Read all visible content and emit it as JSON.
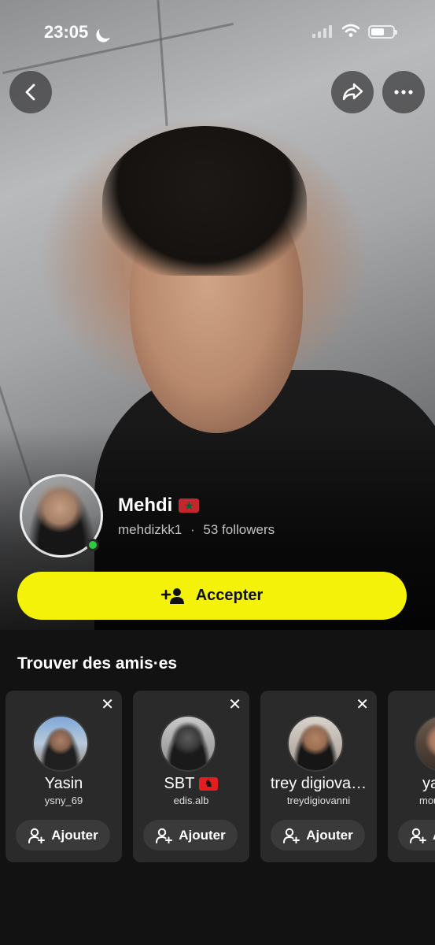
{
  "status_bar": {
    "time": "23:05"
  },
  "profile": {
    "display_name": "Mehdi",
    "display_name_flag": "morocco-flag",
    "username": "mehdizkk1",
    "separator": "·",
    "followers": "53 followers",
    "online": true
  },
  "actions": {
    "accept_label": "Accepter"
  },
  "find_friends": {
    "title": "Trouver des amis·es",
    "cards": [
      {
        "name": "Yasin",
        "handle": "ysny_69",
        "add_label": "Ajouter",
        "close": "✕"
      },
      {
        "name": "SBT",
        "flag": "albania-flag",
        "handle": "edis.alb",
        "add_label": "Ajouter",
        "close": "✕"
      },
      {
        "name": "trey digiova…",
        "handle": "treydigiovanni",
        "add_label": "Ajouter",
        "close": "✕"
      },
      {
        "name": "ya",
        "handle": "mou",
        "add_label": "A"
      }
    ]
  },
  "colors": {
    "accent_yellow": "#f5f20a",
    "background": "#121212",
    "card": "#2a2a2a",
    "online_green": "#2ecc40"
  }
}
